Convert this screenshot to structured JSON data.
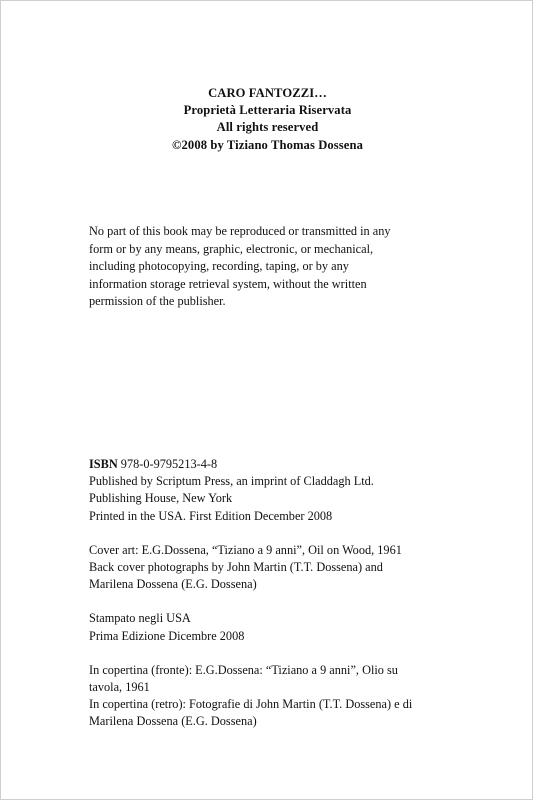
{
  "header": {
    "lines": [
      "CARO FANTOZZI…",
      "Proprietà Letteraria Riservata",
      "All  rights reserved",
      "©2008  by Tiziano Thomas Dossena"
    ]
  },
  "legal": {
    "lines": [
      "No part of this book may be reproduced or transmitted in any",
      "form or by any means, graphic, electronic, or mechanical,",
      "including photocopying, recording, taping, or by any",
      "information storage retrieval system, without the written",
      "permission of the publisher."
    ]
  },
  "publication": {
    "isbn_label": "ISBN",
    "isbn_value": " 978-0-9795213-4-8",
    "publisher_lines": [
      "Published by Scriptum Press, an imprint of Claddagh Ltd.",
      "Publishing House, New York",
      "Printed in the USA. First Edition  December 2008"
    ],
    "cover_lines": [
      "Cover art: E.G.Dossena, “Tiziano a 9 anni”, Oil on Wood, 1961",
      "Back cover photographs by John Martin (T.T. Dossena) and",
      "Marilena Dossena (E.G. Dossena)"
    ],
    "italian_print_lines": [
      "Stampato negli USA",
      "Prima Edizione   Dicembre 2008"
    ],
    "italian_cover_lines": [
      "In copertina (fronte): E.G.Dossena: “Tiziano a 9 anni”, Olio su",
      "tavola, 1961",
      "In copertina (retro): Fotografie di John Martin (T.T. Dossena) e di",
      "Marilena Dossena (E.G. Dossena)"
    ]
  }
}
